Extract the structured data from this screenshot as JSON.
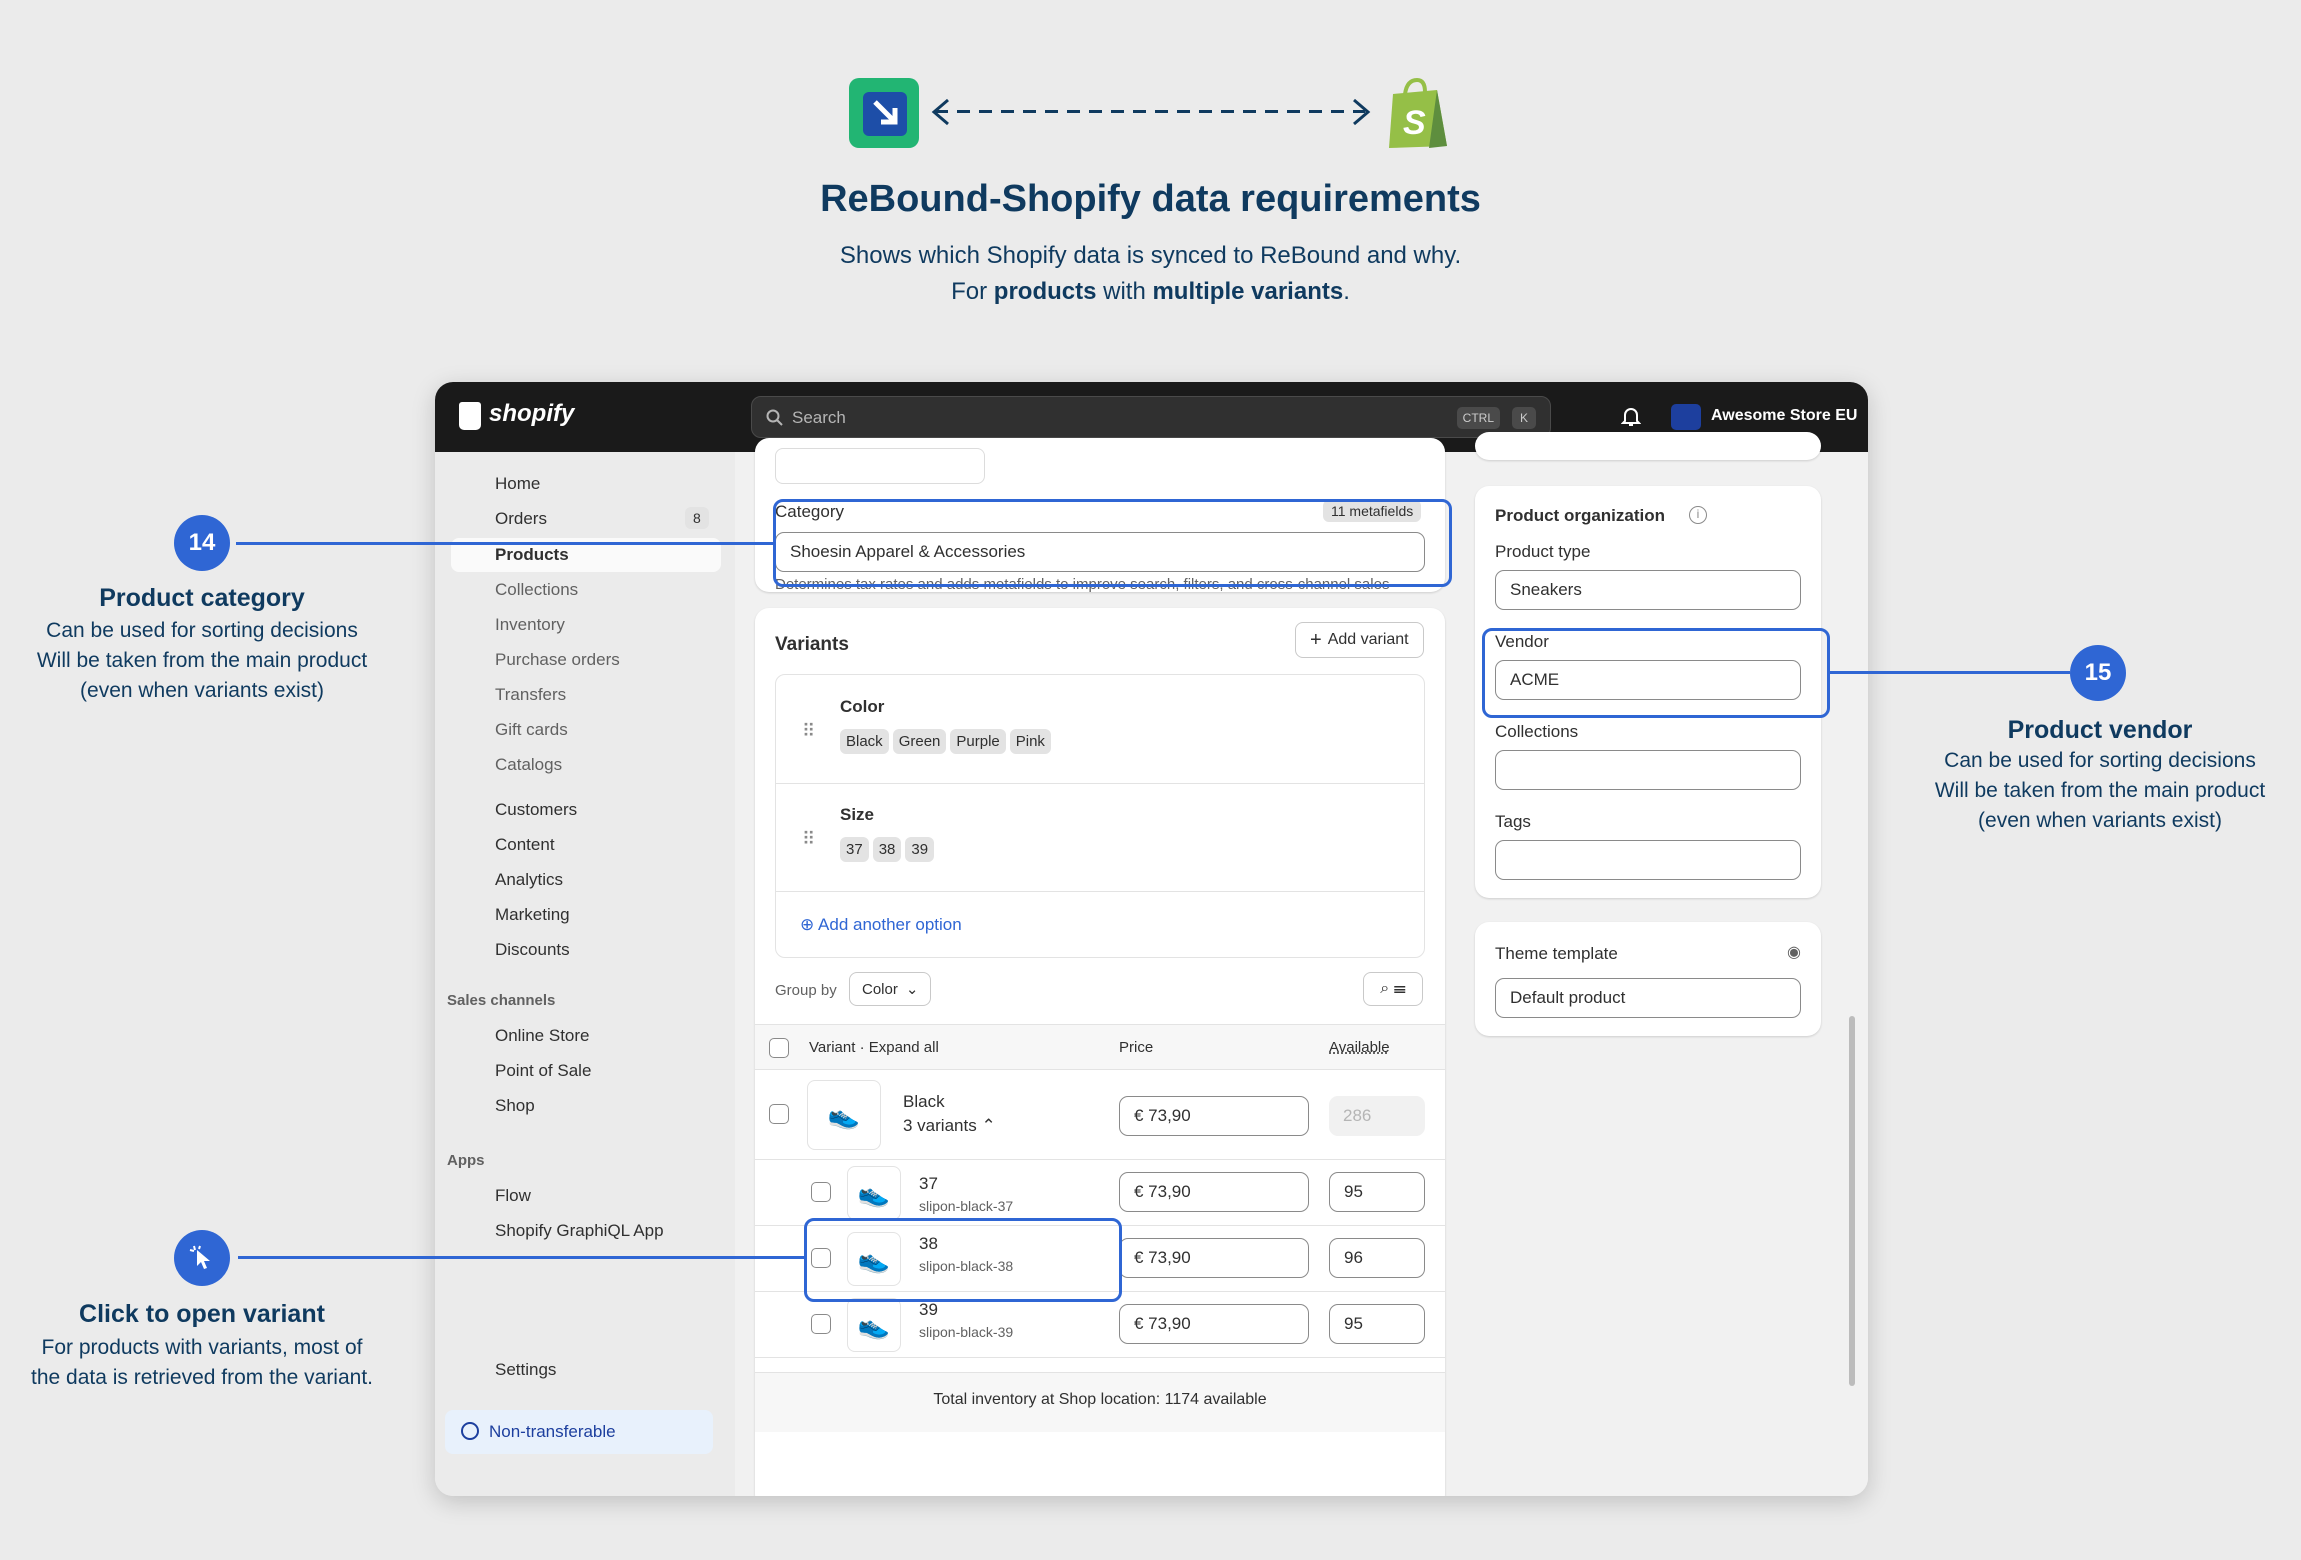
{
  "header": {
    "title": "ReBound-Shopify data requirements",
    "sub1": "Shows which Shopify data is synced to ReBound and why.",
    "sub2_pre": "For ",
    "sub2_b1": "products",
    "sub2_mid": " with ",
    "sub2_b2": "multiple variants",
    "sub2_post": "."
  },
  "topbar": {
    "brand": "shopify",
    "search_placeholder": "Search",
    "kbd1": "CTRL",
    "kbd2": "K",
    "store": "Awesome Store EU"
  },
  "sidebar": {
    "items": [
      "Home",
      "Orders",
      "Products",
      "Collections",
      "Inventory",
      "Purchase orders",
      "Transfers",
      "Gift cards",
      "Catalogs",
      "Customers",
      "Content",
      "Analytics",
      "Marketing",
      "Discounts"
    ],
    "orders_badge": "8",
    "sales_channels": "Sales channels",
    "channels": [
      "Online Store",
      "Point of Sale",
      "Shop"
    ],
    "apps": "Apps",
    "app_items": [
      "Flow",
      "Shopify GraphiQL App"
    ],
    "settings": "Settings",
    "nontransferable": "Non-transferable"
  },
  "category": {
    "label": "Category",
    "metafields": "11 metafields",
    "value_pre": "Shoes",
    "value_post": " in Apparel & Accessories",
    "help": "Determines tax rates and adds metafields to improve search, filters, and cross-channel sales"
  },
  "variants": {
    "title": "Variants",
    "add_variant": "Add variant",
    "color_label": "Color",
    "colors": [
      "Black",
      "Green",
      "Purple",
      "Pink"
    ],
    "size_label": "Size",
    "sizes": [
      "37",
      "38",
      "39"
    ],
    "add_option": "Add another option",
    "group_by": "Group by",
    "group_value": "Color",
    "col_variant": "Variant · Expand all",
    "col_price": "Price",
    "col_available": "Available",
    "parent": {
      "name": "Black",
      "sub": "3 variants",
      "price": "€ 73,90",
      "available": "286"
    },
    "rows": [
      {
        "name": "37",
        "sku": "slipon-black-37",
        "price": "€ 73,90",
        "available": "95"
      },
      {
        "name": "38",
        "sku": "slipon-black-38",
        "price": "€ 73,90",
        "available": "96"
      },
      {
        "name": "39",
        "sku": "slipon-black-39",
        "price": "€ 73,90",
        "available": "95"
      }
    ],
    "total": "Total inventory at Shop location: 1174 available"
  },
  "organization": {
    "title": "Product organization",
    "type_label": "Product type",
    "type_value": "Sneakers",
    "vendor_label": "Vendor",
    "vendor_value": "ACME",
    "collections_label": "Collections",
    "tags_label": "Tags"
  },
  "theme": {
    "label": "Theme template",
    "value": "Default product"
  },
  "callouts": {
    "c14": {
      "num": "14",
      "title": "Product category",
      "lines": [
        "Can be used for sorting decisions",
        "Will be taken from the main product",
        "(even when variants exist)"
      ]
    },
    "c15": {
      "num": "15",
      "title": "Product vendor",
      "lines": [
        "Can be used for sorting decisions",
        "Will be taken from the main product",
        "(even when variants exist)"
      ]
    },
    "click": {
      "title": "Click to open variant",
      "lines": [
        "For products with variants, most of",
        "the data is retrieved from the variant."
      ]
    }
  }
}
